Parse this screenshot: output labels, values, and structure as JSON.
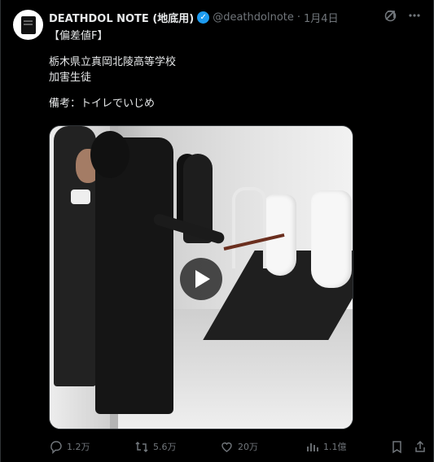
{
  "post": {
    "display_name": "DEATHDOL NOTE (地底用)",
    "handle": "@deathdolnote",
    "separator": "·",
    "date": "1月4日",
    "text_lines": [
      "【偏差値F】",
      "",
      "栃木県立真岡北陵高等学校",
      "加害生徒",
      "",
      "備考：トイレでいじめ"
    ]
  },
  "media": {
    "type": "video",
    "play_icon": "play-icon"
  },
  "actions": {
    "reply_count": "1.2万",
    "repost_count": "5.6万",
    "like_count": "20万",
    "views_count": "1.1億",
    "icons": [
      "reply-icon",
      "repost-icon",
      "heart-icon",
      "views-icon",
      "bookmark-icon",
      "share-icon"
    ]
  },
  "colors": {
    "background": "#000000",
    "text_primary": "#e7e9ea",
    "text_secondary": "#71767b",
    "verified": "#1d9bf0"
  }
}
